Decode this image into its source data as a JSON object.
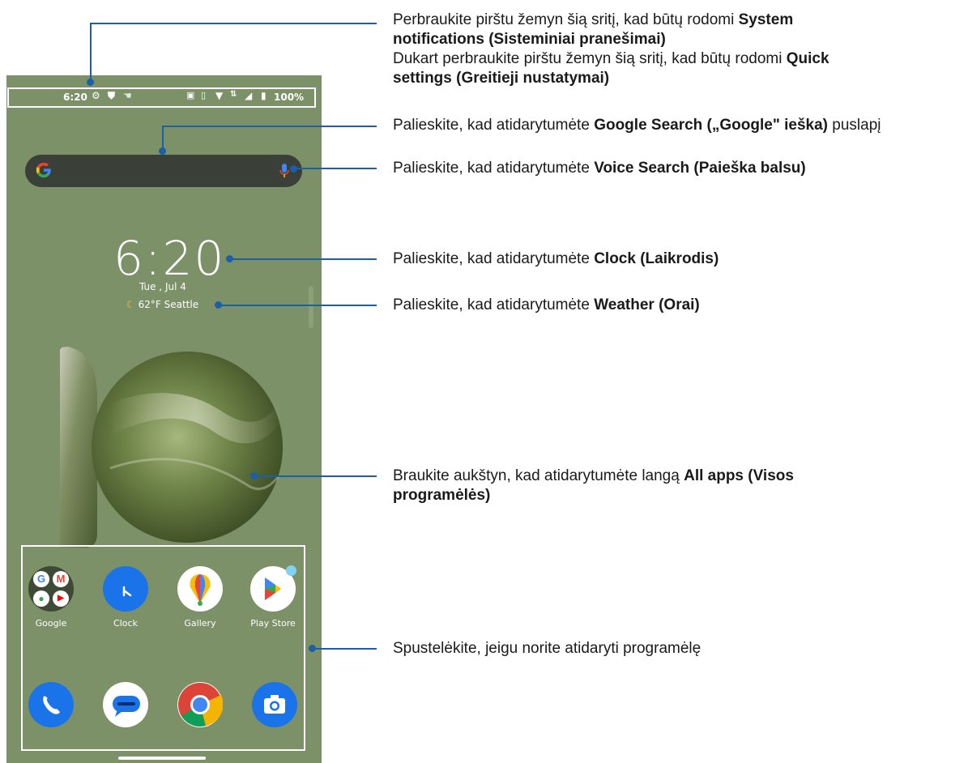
{
  "status_bar": {
    "time": "6:20",
    "battery": "100%",
    "left_icons": [
      "gear-icon",
      "shield-icon",
      "hand-icon"
    ],
    "right_icons": [
      "image-icon",
      "vibrate-icon",
      "wifi-icon",
      "data-icon",
      "signal-icon",
      "battery-icon"
    ]
  },
  "clock": {
    "time": "6:20",
    "date": "Tue , Jul 4"
  },
  "weather": {
    "temp": "62°F",
    "city": "Seattle"
  },
  "apps_row1": [
    {
      "label": "Google",
      "icon": "google-folder-icon"
    },
    {
      "label": "Clock",
      "icon": "clock-icon"
    },
    {
      "label": "Gallery",
      "icon": "gallery-icon"
    },
    {
      "label": "Play Store",
      "icon": "play-store-icon"
    }
  ],
  "apps_row2": [
    {
      "icon": "phone-icon"
    },
    {
      "icon": "messages-icon"
    },
    {
      "icon": "chrome-icon"
    },
    {
      "icon": "camera-icon"
    }
  ],
  "callouts": {
    "status": {
      "l1_pre": "Perbraukite pirštu žemyn šią sritį, kad būtų rodomi ",
      "l1_bold": "System",
      "l2_bold": "notifications (Sisteminiai pranešimai)",
      "l3_pre": "Dukart perbraukite pirštu žemyn šią sritį, kad būtų rodomi ",
      "l3_bold": "Quick",
      "l4_bold": "settings (Greitieji nustatymai)"
    },
    "google": {
      "pre": "Palieskite, kad atidarytumėte ",
      "bold": "Google Search („Google\" ieška)",
      "post": " puslapį"
    },
    "voice": {
      "pre": "Palieskite, kad atidarytumėte ",
      "bold": "Voice Search (Paieška balsu)"
    },
    "clock": {
      "pre": "Palieskite, kad atidarytumėte ",
      "bold": "Clock (Laikrodis)"
    },
    "weather": {
      "pre": "Palieskite, kad atidarytumėte ",
      "bold": "Weather (Orai)"
    },
    "allapps": {
      "pre": "Braukite aukštyn, kad atidarytumėte langą ",
      "bold1": "All apps (Visos",
      "bold2": "programėlės)"
    },
    "apps": {
      "text": "Spustelėkite, jeigu norite atidaryti programėlę"
    }
  },
  "colors": {
    "wallpaper": "#7c9168",
    "callout_line": "#1c5fa8"
  }
}
